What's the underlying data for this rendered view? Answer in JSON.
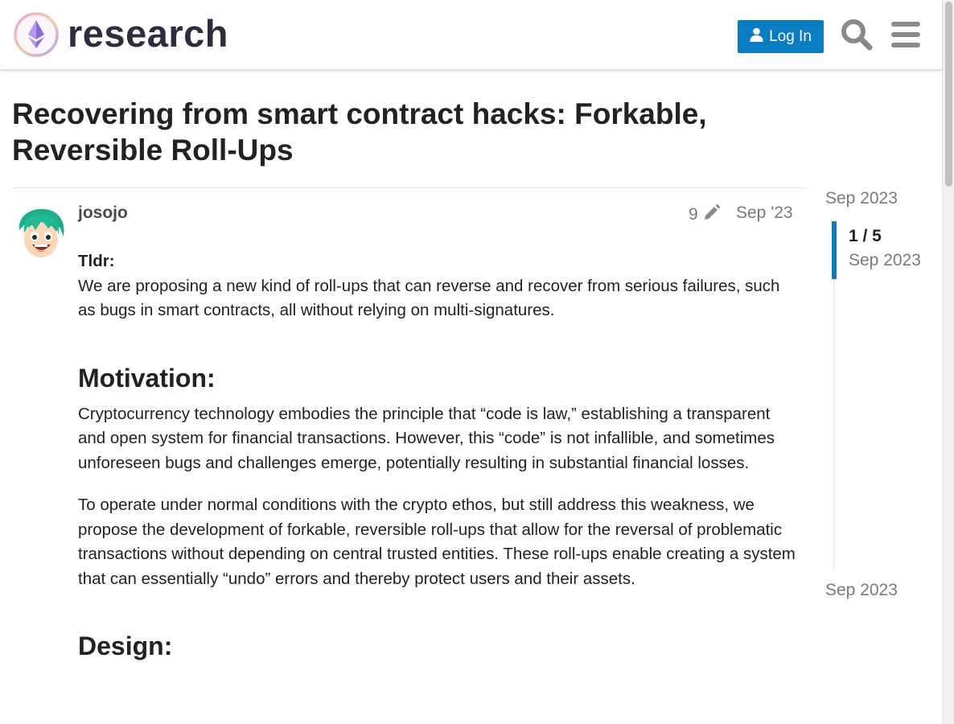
{
  "header": {
    "site_name": "research",
    "login_label": "Log In",
    "icons": [
      "ethereum-logo",
      "user-icon",
      "search-icon",
      "hamburger-menu-icon"
    ],
    "accent_color": "#0a7cc2"
  },
  "topic": {
    "title": "Recovering from smart contract hacks: Forkable, Reversible Roll-Ups"
  },
  "post": {
    "username": "josojo",
    "edit_count": "9",
    "date": "Sep '23",
    "tldr_label": "Tldr:",
    "tldr_text": "We are proposing a new kind of roll-ups that can reverse and recover from serious failures, such as bugs in smart contracts, all without relying on multi-signatures.",
    "motivation_heading": "Motivation:",
    "motivation_p1": "Cryptocurrency technology embodies the principle that “code is law,” establishing a transparent and open system for financial transactions. However, this “code” is not infallible, and sometimes unforeseen bugs and challenges emerge, potentially resulting in substantial financial losses.",
    "motivation_p2": "To operate under normal conditions with the crypto ethos, but still address this weakness, we propose the development of forkable, reversible roll-ups that allow for the reversal of problematic transactions without depending on central trusted entities. These roll-ups enable creating a system that can essentially “undo” errors and thereby protect users and their assets.",
    "design_heading": "Design:"
  },
  "timeline": {
    "start_date": "Sep 2023",
    "position": "1 / 5",
    "position_date": "Sep 2023",
    "end_date": "Sep 2023"
  }
}
